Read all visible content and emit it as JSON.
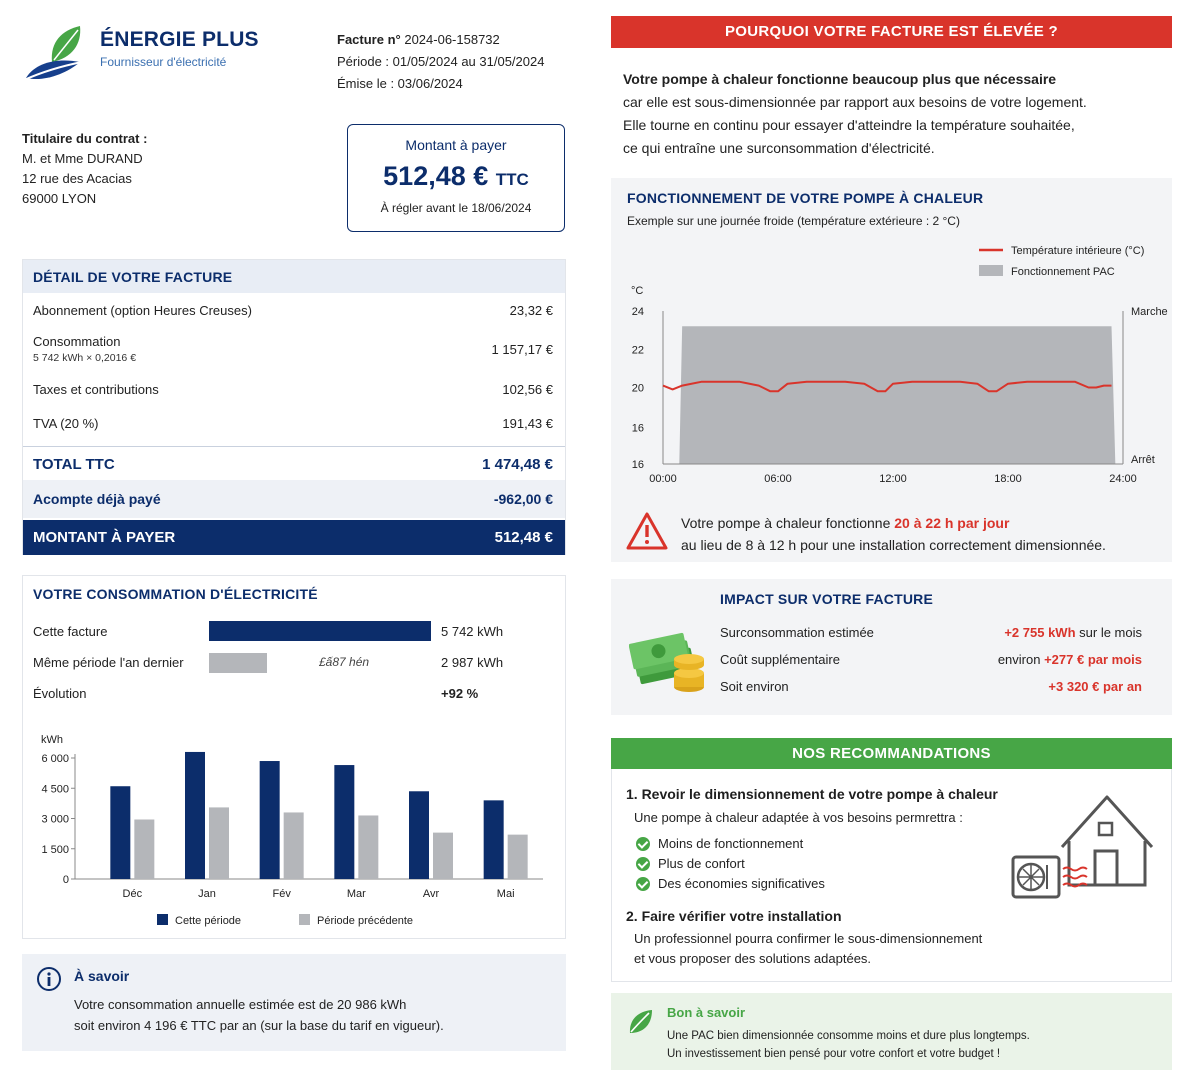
{
  "brand": {
    "name": "ÉNERGIE PLUS",
    "subtitle": "Fournisseur d'électricité"
  },
  "invoice": {
    "number_label": "Facture n°",
    "number": "2024-06-158732",
    "period": "Période : 01/05/2024 au 31/05/2024",
    "issued": "Émise le : 03/06/2024"
  },
  "holder": {
    "title": "Titulaire du contrat :",
    "name": "M. et Mme DURAND",
    "address1": "12 rue des Acacias",
    "address2": "69000 LYON"
  },
  "amount_box": {
    "label": "Montant à payer",
    "value": "512,48 €",
    "ttc": "TTC",
    "due": "À régler avant le 18/06/2024"
  },
  "detail": {
    "title": "DÉTAIL DE VOTRE FACTURE",
    "rows": [
      {
        "label": "Abonnement (option Heures Creuses)",
        "sub": "",
        "value": "23,32 €"
      },
      {
        "label": "Consommation",
        "sub": "5 742 kWh × 0,2016 €",
        "value": "1 157,17 €"
      },
      {
        "label": "Taxes et contributions",
        "sub": "",
        "value": "102,56 €"
      },
      {
        "label": "TVA (20 %)",
        "sub": "",
        "value": "191,43 €"
      }
    ],
    "total": {
      "label": "TOTAL TTC",
      "value": "1 474,48 €"
    },
    "acompte": {
      "label": "Acompte déjà payé",
      "value": "-962,00 €"
    },
    "to_pay": {
      "label": "MONTANT À PAYER",
      "value": "512,48 €"
    }
  },
  "consumption": {
    "title": "VOTRE CONSOMMATION D'ÉLECTRICITÉ",
    "current": {
      "label": "Cette facture",
      "value": "5 742 kWh",
      "kwh": 5742
    },
    "previous": {
      "label": "Même période l'an dernier",
      "value": "2 987 kWh",
      "kwh": 2987,
      "bar_text": "£ấ87 hén"
    },
    "evolution": {
      "label": "Évolution",
      "value": "+92 %"
    },
    "colors": {
      "current": "#0c2d6b",
      "previous": "#b4b6ba"
    }
  },
  "chart_data": [
    {
      "type": "bar",
      "title": "",
      "ylabel": "kWh",
      "xlabel": "",
      "ylim": [
        0,
        6000
      ],
      "yticks": [
        "0",
        "1 500",
        "3 000",
        "4 500",
        "6 000"
      ],
      "categories": [
        "Déc",
        "Jan",
        "Fév",
        "Mar",
        "Avr",
        "Mai"
      ],
      "series": [
        {
          "name": "Cette période",
          "color": "#0c2d6b",
          "values": [
            4600,
            6300,
            5850,
            5650,
            4350,
            3900
          ]
        },
        {
          "name": "Période précédente",
          "color": "#b4b6ba",
          "values": [
            2950,
            3550,
            3300,
            3150,
            2300,
            2200
          ]
        }
      ],
      "legend": "bottom",
      "grid": false
    },
    {
      "type": "line",
      "title": "FONCTIONNEMENT DE VOTRE POMPE À CHALEUR",
      "subtitle": "Exemple sur une journée froide (température extérieure : 2 °C)",
      "ylabel": "°C",
      "ylim": [
        16,
        24
      ],
      "yticks": [
        "16",
        "16",
        "20",
        "22",
        "24"
      ],
      "xticks": [
        "00:00",
        "06:00",
        "12:00",
        "18:00",
        "24:00"
      ],
      "right_axis": {
        "top": "Marche",
        "bottom": "Arrêt"
      },
      "series": [
        {
          "name": "Température intérieure (°C)",
          "color": "#d9342b",
          "points": [
            [
              0.0,
              20.1
            ],
            [
              0.5,
              19.9
            ],
            [
              1.0,
              20.1
            ],
            [
              2.0,
              20.3
            ],
            [
              3.0,
              20.3
            ],
            [
              4.0,
              20.3
            ],
            [
              5.0,
              20.1
            ],
            [
              5.6,
              19.8
            ],
            [
              6.0,
              19.8
            ],
            [
              6.5,
              20.2
            ],
            [
              7.5,
              20.3
            ],
            [
              9.5,
              20.3
            ],
            [
              10.5,
              20.2
            ],
            [
              11.2,
              19.8
            ],
            [
              11.6,
              19.8
            ],
            [
              12.0,
              20.2
            ],
            [
              13.0,
              20.3
            ],
            [
              15.5,
              20.3
            ],
            [
              16.4,
              20.2
            ],
            [
              17.0,
              19.8
            ],
            [
              17.4,
              19.8
            ],
            [
              18.0,
              20.2
            ],
            [
              19.0,
              20.3
            ],
            [
              21.5,
              20.3
            ],
            [
              22.2,
              20.0
            ],
            [
              22.6,
              20.0
            ],
            [
              23.0,
              20.1
            ],
            [
              23.4,
              20.1
            ]
          ]
        },
        {
          "name": "Fonctionnement PAC",
          "color": "#b4b6ba",
          "on_from": 1.0,
          "on_to": 23.4,
          "ramp_start": 0.85,
          "ramp_end": 23.6
        }
      ],
      "legend": "top-right",
      "grid": false
    }
  ],
  "savoir": {
    "title": "À savoir",
    "line1": "Votre consommation annuelle estimée est de 20 986 kWh",
    "line2": "soit environ 4 196 € TTC par an (sur la base du tarif en vigueur)."
  },
  "why": {
    "banner": "POURQUOI VOTRE FACTURE EST ÉLEVÉE ?",
    "lead": "Votre pompe à chaleur fonctionne beaucoup plus que nécessaire",
    "line2": "car elle est sous-dimensionnée par rapport aux besoins de votre logement.",
    "line3": "Elle tourne en continu pour essayer d'atteindre la température souhaitée,",
    "line4": "ce qui entraîne une surconsommation d'électricité."
  },
  "warning": {
    "prefix": "Votre pompe à chaleur fonctionne",
    "highlight": "20 à 22 h par jour",
    "line2": "au lieu de 8 à 12 h pour une installation correctement dimensionnée."
  },
  "impact": {
    "title": "IMPACT SUR VOTRE FACTURE",
    "rows": [
      {
        "label": "Surconsommation estimée",
        "pre": "",
        "highlight": "+2 755 kWh",
        "post": " sur le mois"
      },
      {
        "label": "Coût supplémentaire",
        "pre": "environ ",
        "highlight": "+277 € par mois",
        "post": ""
      },
      {
        "label": "Soit environ",
        "pre": "",
        "highlight": "+3 320 € par an",
        "post": ""
      }
    ]
  },
  "reco": {
    "banner": "NOS RECOMMANDATIONS",
    "h1": "1. Revoir le dimensionnement de votre pompe à chaleur",
    "p1": "Une pompe à chaleur adaptée à vos besoins permrettra :",
    "checks": [
      "Moins de fonctionnement",
      "Plus de confort",
      "Des économies significatives"
    ],
    "h2": "2. Faire vérifier votre installation",
    "p2a": "Un professionnel pourra confirmer le sous-dimensionnement",
    "p2b": "et vous proposer des solutions adaptées."
  },
  "bon": {
    "title": "Bon à savoir",
    "line1": "Une PAC bien dimensionnée consomme moins et dure plus longtemps.",
    "line2": "Un investissement bien pensé pour votre confort et votre budget !"
  }
}
